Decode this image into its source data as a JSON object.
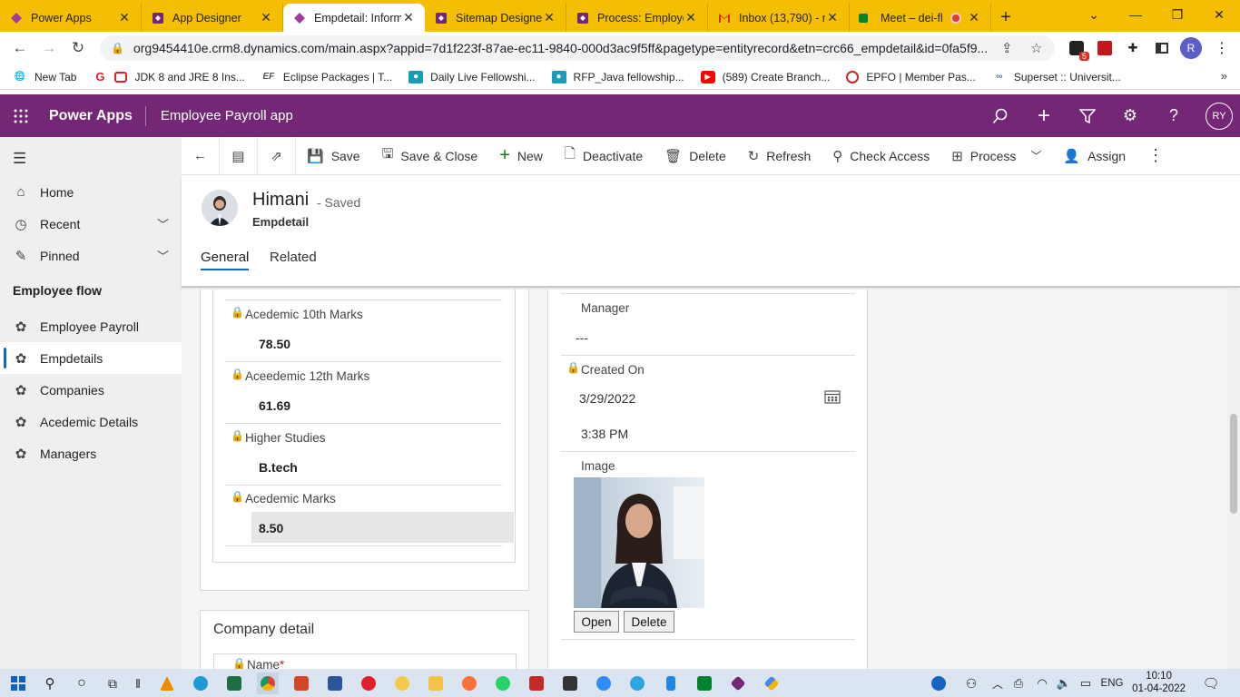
{
  "browser": {
    "tabs": [
      {
        "title": "Power Apps",
        "icon": "powerapps-icon",
        "color": "#a33b9a"
      },
      {
        "title": "App Designer",
        "icon": "powerapps-icon",
        "color": "#742774"
      },
      {
        "title": "Empdetail: Inform",
        "icon": "powerapps-icon",
        "color": "#a33b9a"
      },
      {
        "title": "Sitemap Designe",
        "icon": "powerapps-icon",
        "color": "#742774"
      },
      {
        "title": "Process: Employe",
        "icon": "powerapps-icon",
        "color": "#742774"
      },
      {
        "title": "Inbox (13,790) - r",
        "icon": "gmail-icon",
        "color": "#d93025"
      },
      {
        "title": "Meet – dei-fl",
        "icon": "meet-icon",
        "color": "#00832d"
      }
    ],
    "url": "org9454410e.crm8.dynamics.com/main.aspx?appid=7d1f223f-87ae-ec11-9840-000d3ac9f5ff&pagetype=entityrecord&etn=crc66_empdetail&id=0fa5f9...",
    "extensions_badge": "5",
    "profile_initial": "R",
    "bookmarks": [
      {
        "label": "New Tab",
        "icon": "globe-icon"
      },
      {
        "label": "JDK 8 and JRE 8 Ins...",
        "icon": "oracle-icon"
      },
      {
        "label": "Eclipse Packages | T...",
        "icon": "eclipse-icon"
      },
      {
        "label": "Daily Live Fellowshi...",
        "icon": "person-icon"
      },
      {
        "label": "RFP_Java fellowship...",
        "icon": "person-icon"
      },
      {
        "label": "(589) Create Branch...",
        "icon": "youtube-icon"
      },
      {
        "label": "EPFO | Member Pas...",
        "icon": "epfo-icon"
      },
      {
        "label": "Superset :: Universit...",
        "icon": "superset-icon"
      }
    ]
  },
  "app": {
    "brand": "Power Apps",
    "name": "Employee Payroll app",
    "user_initials": "RY"
  },
  "sidebar": {
    "items": [
      {
        "label": "Home",
        "icon": "home-icon"
      },
      {
        "label": "Recent",
        "icon": "clock-icon"
      },
      {
        "label": "Pinned",
        "icon": "pin-icon"
      }
    ],
    "group_title": "Employee flow",
    "entities": [
      {
        "label": "Employee Payroll"
      },
      {
        "label": "Empdetails"
      },
      {
        "label": "Companies"
      },
      {
        "label": "Acedemic Details"
      },
      {
        "label": "Managers"
      }
    ]
  },
  "commands": {
    "save": "Save",
    "save_close": "Save & Close",
    "new": "New",
    "deactivate": "Deactivate",
    "delete": "Delete",
    "refresh": "Refresh",
    "check_access": "Check Access",
    "process": "Process",
    "assign": "Assign"
  },
  "record": {
    "name": "Himani",
    "status": "- Saved",
    "entity": "Empdetail",
    "tabs": [
      "General",
      "Related"
    ]
  },
  "left_fields": [
    {
      "label": "Acedemic 10th Marks",
      "value": "78.50"
    },
    {
      "label": "Aceedemic 12th Marks",
      "value": "61.69"
    },
    {
      "label": "Higher Studies",
      "value": "B.tech"
    },
    {
      "label": "Acedemic Marks",
      "value": "8.50"
    }
  ],
  "company_section": {
    "title": "Company detail",
    "first_field_label": "Name",
    "required_marker": "*"
  },
  "right_fields": {
    "manager_label": "Manager",
    "manager_value": "---",
    "created_label": "Created On",
    "created_date": "3/29/2022",
    "created_time": "3:38 PM",
    "image_label": "Image",
    "open_btn": "Open",
    "delete_btn": "Delete"
  },
  "taskbar": {
    "time": "10:10",
    "date": "01-04-2022",
    "lang": "ENG"
  },
  "colors": {
    "header": "#742774",
    "tabstrip": "#f4bf00",
    "accent": "#0f6cbd"
  }
}
